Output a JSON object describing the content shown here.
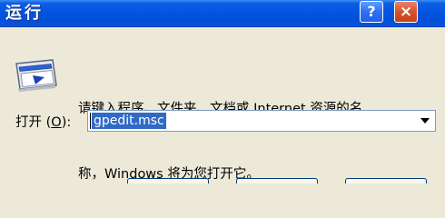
{
  "window": {
    "title": "运行",
    "help_glyph": "?",
    "close_glyph": "×"
  },
  "dialog": {
    "icon": "run-program-icon",
    "prompt_line1": "请键入程序、文件夹、文档或 Internet 资源的名",
    "prompt_line2": "称，Windows 将为您打开它。",
    "open_label_text": "打开 (",
    "open_label_key": "O",
    "open_label_end": "):",
    "combo_value": "gpedit.msc"
  },
  "colors": {
    "titlebar": "#0454e0",
    "dialog_bg": "#ece9d8",
    "selection": "#316ac5",
    "close_button": "#d5522b"
  }
}
